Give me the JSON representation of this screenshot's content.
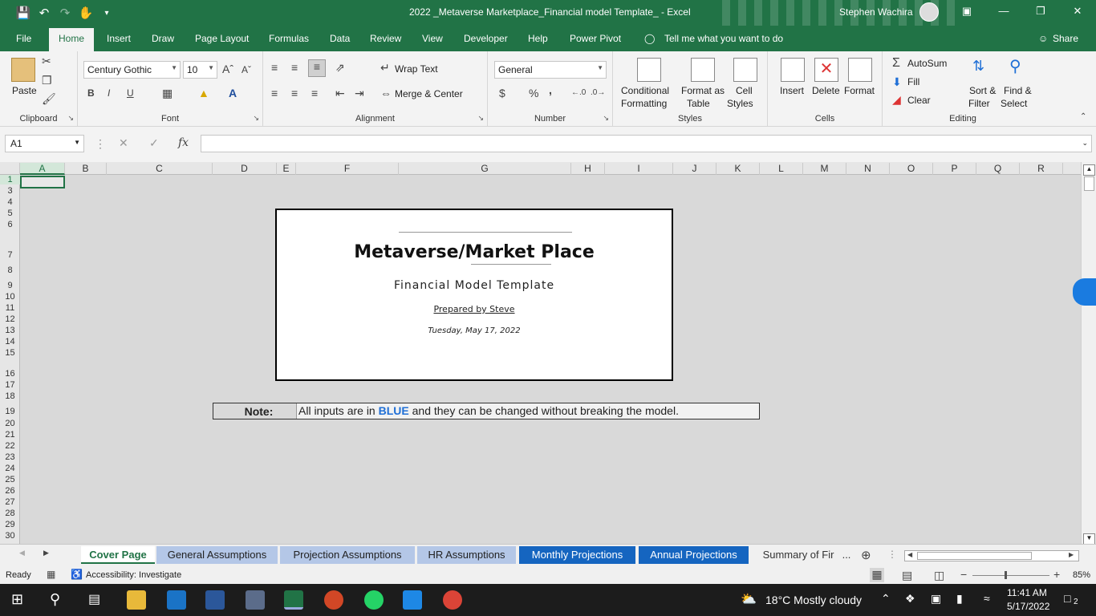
{
  "titlebar": {
    "title": "2022 _Metaverse Marketplace_Financial model Template_  -  Excel",
    "user": "Stephen Wachira"
  },
  "tabs": [
    "File",
    "Home",
    "Insert",
    "Draw",
    "Page Layout",
    "Formulas",
    "Data",
    "Review",
    "View",
    "Developer",
    "Help",
    "Power Pivot"
  ],
  "tell_me": "Tell me what you want to do",
  "share": "Share",
  "ribbon": {
    "clipboard": {
      "label": "Clipboard",
      "paste": "Paste"
    },
    "font": {
      "label": "Font",
      "name": "Century Gothic",
      "size": "10",
      "bold": "B",
      "italic": "I",
      "underline": "U"
    },
    "alignment": {
      "label": "Alignment",
      "wrap": "Wrap Text",
      "merge": "Merge & Center"
    },
    "number": {
      "label": "Number",
      "format": "General",
      "currency": "$",
      "percent": "%",
      "comma": ","
    },
    "styles": {
      "label": "Styles",
      "conditional_1": "Conditional",
      "conditional_2": "Formatting",
      "format_as_1": "Format as",
      "format_as_2": "Table",
      "cell_styles_1": "Cell",
      "cell_styles_2": "Styles"
    },
    "cells": {
      "label": "Cells",
      "insert": "Insert",
      "delete": "Delete",
      "format": "Format"
    },
    "editing": {
      "label": "Editing",
      "autosum": "AutoSum",
      "fill": "Fill",
      "clear": "Clear",
      "sort_1": "Sort &",
      "sort_2": "Filter",
      "find_1": "Find &",
      "find_2": "Select"
    }
  },
  "formula_bar": {
    "name_box": "A1",
    "fx": "fx",
    "formula": ""
  },
  "columns": [
    "A",
    "B",
    "C",
    "D",
    "E",
    "F",
    "G",
    "H",
    "I",
    "J",
    "K",
    "L",
    "M",
    "N",
    "O",
    "P",
    "Q",
    "R"
  ],
  "rows": [
    "1",
    "3",
    "4",
    "5",
    "6",
    "7",
    "8",
    "9",
    "10",
    "11",
    "12",
    "13",
    "14",
    "15",
    "16",
    "17",
    "18",
    "19",
    "20",
    "21",
    "22",
    "23",
    "24",
    "25",
    "26",
    "27",
    "28",
    "29",
    "30"
  ],
  "cover": {
    "title": "Metaverse/Market Place",
    "subtitle": "Financial  Model  Template",
    "prepared": "Prepared by Steve",
    "date": "Tuesday, May 17, 2022"
  },
  "note": {
    "label": "Note:",
    "text_before": "All inputs are in ",
    "highlight": "BLUE",
    "text_after": " and they can be changed without breaking the model."
  },
  "sheets": [
    "Cover Page",
    "General Assumptions",
    "Projection Assumptions",
    "HR Assumptions",
    "Monthly Projections",
    "Annual Projections",
    "Summary of Fir"
  ],
  "sheets_more": "...",
  "status": {
    "ready": "Ready",
    "accessibility": "Accessibility: Investigate",
    "zoom": "85%"
  },
  "taskbar": {
    "weather": "18°C  Mostly cloudy",
    "time": "11:41 AM",
    "date": "5/17/2022",
    "notifications": "2"
  },
  "colors": {
    "excel_green": "#217346",
    "blue_input": "#1f6fd6",
    "tab_dark_blue": "#1565c0",
    "tab_light_blue": "#b4c7e7"
  }
}
